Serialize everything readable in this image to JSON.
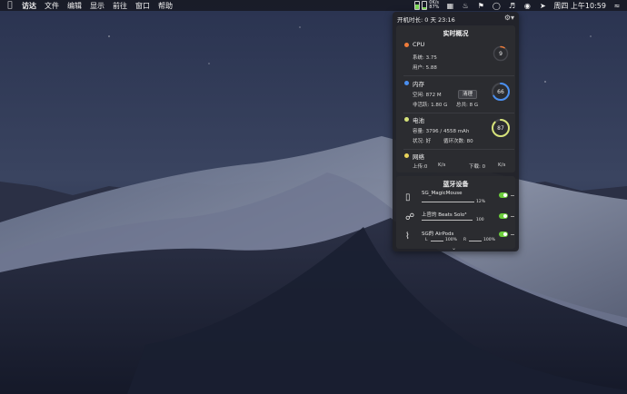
{
  "menubar": {
    "app_name": "访达",
    "menus": [
      "文件",
      "编辑",
      "显示",
      "前往",
      "窗口",
      "帮助"
    ],
    "stats": {
      "top": "0K/s",
      "bottom": "87%"
    },
    "clock": "周四 上午10:59",
    "icons": [
      "memory-bar-icon",
      "stats-icon",
      "bell-icon",
      "flag-icon",
      "vpn-icon",
      "volume-icon",
      "browser-icon",
      "location-icon",
      "wifi-icon"
    ]
  },
  "panel": {
    "uptime": "开机时长: 0 天 23:16",
    "overview_title": "实时概况",
    "cpu": {
      "title": "CPU",
      "system": "系统: 3.75",
      "user": "用户: 5.88",
      "gauge": "9",
      "level": 9,
      "color": "#ef7c3a"
    },
    "memory": {
      "title": "内存",
      "free": "空闲: 872  M",
      "clean_label": "清理",
      "inactive": "非活跃: 1.80   G",
      "total": "总共: 8  G",
      "gauge": "66",
      "level": 66,
      "color": "#4a8ff0"
    },
    "battery": {
      "title": "电池",
      "capacity": "容量: 3796 / 4558 mAh",
      "status": "状况: 好",
      "cycles": "循环次数: 80",
      "gauge": "87",
      "level": 87,
      "color": "#d6e27a"
    },
    "network": {
      "title": "网络",
      "upload": "上传:0",
      "upload_unit": "K/s",
      "download": "下载: 0",
      "download_unit": "K/s",
      "color": "#e8d35a"
    },
    "bluetooth": {
      "title": "蓝牙设备",
      "devices": [
        {
          "name": "SG_MagicMouse",
          "value": "12%",
          "level": 12,
          "icon": "mouse-icon"
        },
        {
          "name": "上官的 Beats Solo³",
          "value": "100",
          "level": 100,
          "icon": "headphones-icon"
        },
        {
          "name": "SG的 AirPods",
          "left_label": "L",
          "left_value": "100%",
          "right_label": "R",
          "right_value": "100%",
          "icon": "airpods-icon"
        }
      ]
    }
  }
}
